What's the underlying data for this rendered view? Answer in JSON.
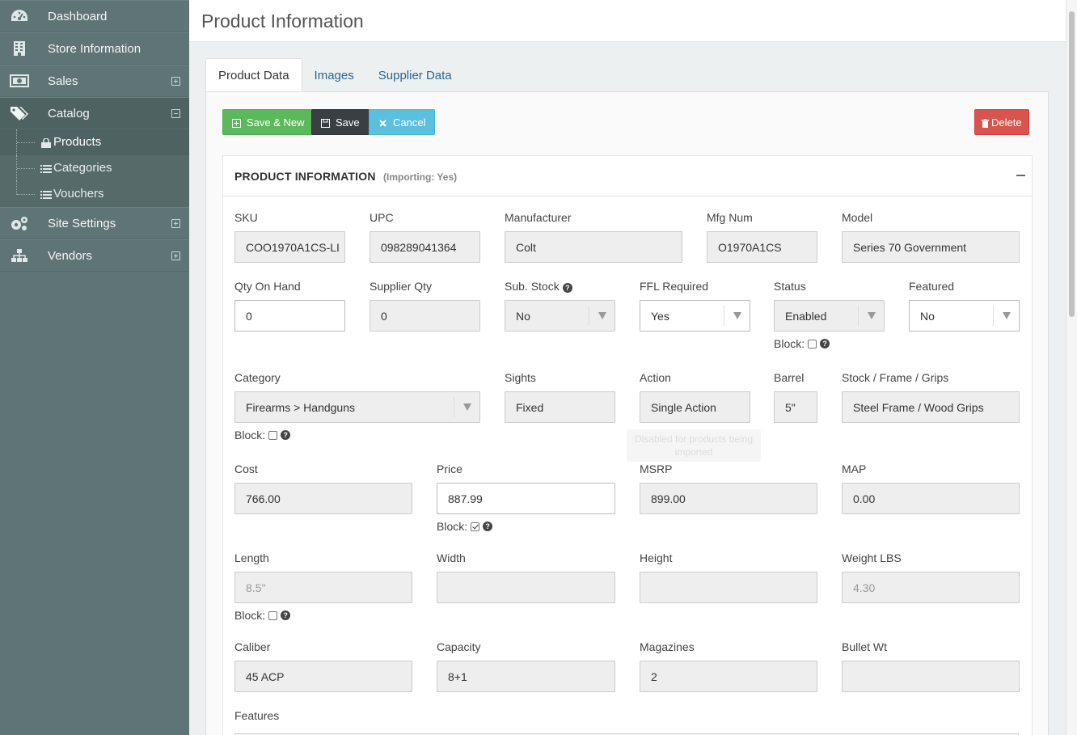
{
  "sidebar": {
    "items": [
      {
        "label": "Dashboard",
        "icon": "dashboard-icon"
      },
      {
        "label": "Store Information",
        "icon": "building-icon"
      },
      {
        "label": "Sales",
        "icon": "money-icon"
      },
      {
        "label": "Catalog",
        "icon": "tags-icon"
      },
      {
        "label": "Site Settings",
        "icon": "gears-icon"
      },
      {
        "label": "Vendors",
        "icon": "sitemap-icon"
      }
    ],
    "catalog_sub": [
      {
        "label": "Products",
        "icon": "lock-icon"
      },
      {
        "label": "Categories",
        "icon": "list-icon"
      },
      {
        "label": "Vouchers",
        "icon": "list-icon"
      }
    ]
  },
  "header": {
    "title": "Product Information"
  },
  "tabs": [
    {
      "label": "Product Data"
    },
    {
      "label": "Images"
    },
    {
      "label": "Supplier Data"
    }
  ],
  "buttons": {
    "save_new": "Save & New",
    "save": "Save",
    "cancel": "Cancel",
    "delete": "Delete"
  },
  "panel": {
    "title": "PRODUCT INFORMATION",
    "subtitle": "(Importing: Yes)"
  },
  "block_label": "Block:",
  "fields": {
    "sku": {
      "label": "SKU",
      "value": "COO1970A1CS-LI"
    },
    "upc": {
      "label": "UPC",
      "value": "098289041364"
    },
    "manufacturer": {
      "label": "Manufacturer",
      "value": "Colt"
    },
    "mfg_num": {
      "label": "Mfg Num",
      "value": "O1970A1CS"
    },
    "model": {
      "label": "Model",
      "value": "Series 70 Government"
    },
    "qty_on_hand": {
      "label": "Qty On Hand",
      "value": "0"
    },
    "supplier_qty": {
      "label": "Supplier Qty",
      "value": "0"
    },
    "sub_stock": {
      "label": "Sub. Stock",
      "value": "No"
    },
    "ffl_required": {
      "label": "FFL Required",
      "value": "Yes"
    },
    "status": {
      "label": "Status",
      "value": "Enabled"
    },
    "featured": {
      "label": "Featured",
      "value": "No"
    },
    "category": {
      "label": "Category",
      "value": "Firearms > Handguns"
    },
    "sights": {
      "label": "Sights",
      "value": "Fixed"
    },
    "action": {
      "label": "Action",
      "value": "Single Action"
    },
    "barrel": {
      "label": "Barrel",
      "value": "5\""
    },
    "stock": {
      "label": "Stock / Frame / Grips",
      "value": "Steel Frame / Wood Grips"
    },
    "cost": {
      "label": "Cost",
      "value": "766.00"
    },
    "price": {
      "label": "Price",
      "value": "887.99"
    },
    "msrp": {
      "label": "MSRP",
      "value": "899.00"
    },
    "map": {
      "label": "MAP",
      "value": "0.00"
    },
    "length": {
      "label": "Length",
      "placeholder": "8.5\""
    },
    "width": {
      "label": "Width",
      "value": ""
    },
    "height": {
      "label": "Height",
      "value": ""
    },
    "weight": {
      "label": "Weight LBS",
      "placeholder": "4.30"
    },
    "caliber": {
      "label": "Caliber",
      "value": "45 ACP"
    },
    "capacity": {
      "label": "Capacity",
      "value": "8+1"
    },
    "magazines": {
      "label": "Magazines",
      "value": "2"
    },
    "bullet_wt": {
      "label": "Bullet Wt",
      "value": ""
    },
    "features": {
      "label": "Features"
    }
  },
  "tooltip": {
    "text": "Disabled for products being imported"
  }
}
